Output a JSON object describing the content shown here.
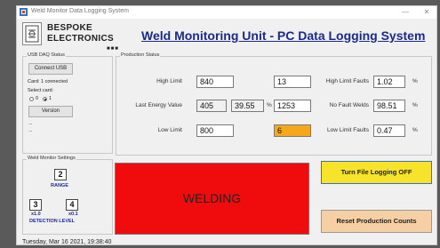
{
  "window": {
    "title": "Weld Monitor Data Logging System",
    "minimize": "—",
    "close": "✕"
  },
  "logo": {
    "line1": "BESPOKE",
    "line2": "ELECTRONICS",
    "dots": "■■■"
  },
  "header": {
    "title": "Weld Monitoring Unit - PC Data Logging System"
  },
  "usb": {
    "group_title": "USB DAQ Status",
    "connect_label": "Connect USB",
    "status": "Card: 1 connected",
    "select_label": "Select card:",
    "radio0": "0",
    "radio1": "1",
    "selected_card": "1",
    "version_label": "Version",
    "info1": "...",
    "info2": "..."
  },
  "settings": {
    "group_title": "Weld Monitor Settings",
    "range_value": "2",
    "range_label": "RANGE",
    "coarse_value": "3",
    "coarse_unit": "x1.0",
    "fine_value": "4",
    "fine_unit": "x0.1",
    "detection_label": "DETECTION LEVEL"
  },
  "production": {
    "group_title": "Production Status",
    "high_limit_label": "High Limit",
    "high_limit": "840",
    "last_energy_label": "Last Energy Value",
    "last_energy": "405",
    "last_energy_pct": "39.55",
    "pct_symbol": "%",
    "low_limit_label": "Low Limit",
    "low_limit": "800",
    "counter_high": "13",
    "counter_ok": "1253",
    "counter_low": "6",
    "high_faults_label": "High Limit Faults",
    "high_faults_pct": "1.02",
    "no_fault_label": "No Fault Welds",
    "no_fault_pct": "98.51",
    "low_faults_label": "Low Limit Faults",
    "low_faults_pct": "0.47"
  },
  "status_indicator": {
    "label": "WELDING",
    "color": "#f00c0c"
  },
  "buttons": {
    "logging_label": "Turn File Logging OFF",
    "reset_label": "Reset Production Counts"
  },
  "status_bar": {
    "datetime": "Tuesday, Mar 16 2021, 19:38:40"
  },
  "colors": {
    "accent_title": "#1a2a8c",
    "logging_button": "#f7e32a",
    "reset_button": "#f6cfa5",
    "low_count_field": "#f5a81c"
  }
}
